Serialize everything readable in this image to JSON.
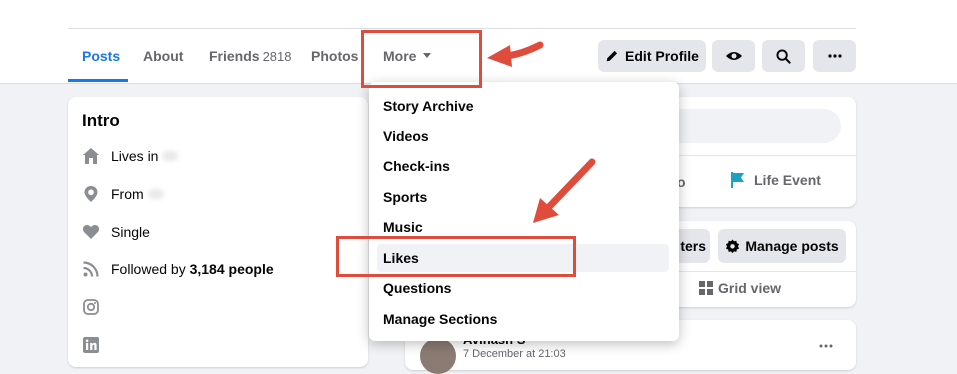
{
  "tabs": {
    "posts": "Posts",
    "about": "About",
    "friends": "Friends",
    "friends_count": "2818",
    "photos": "Photos",
    "more": "More"
  },
  "actions": {
    "edit_profile": "Edit Profile"
  },
  "intro": {
    "title": "Intro",
    "lives_in": "Lives in",
    "from": "From",
    "relationship": "Single",
    "followed_prefix": "Followed by",
    "followers": "3,184 people"
  },
  "menu": {
    "items": [
      "Story Archive",
      "Videos",
      "Check-ins",
      "Sports",
      "Music",
      "Likes",
      "Questions",
      "Manage Sections"
    ]
  },
  "right_panel": {
    "life_event": "Life Event",
    "filters_partial": "ters",
    "manage_posts": "Manage posts",
    "grid_view": "Grid view",
    "post_author_partial": "Avinash S",
    "post_date": "7 December at 21:03"
  },
  "colors": {
    "accent": "#1877f2",
    "annotation": "#e04c3c",
    "life_event_icon": "#1ba1c4"
  }
}
